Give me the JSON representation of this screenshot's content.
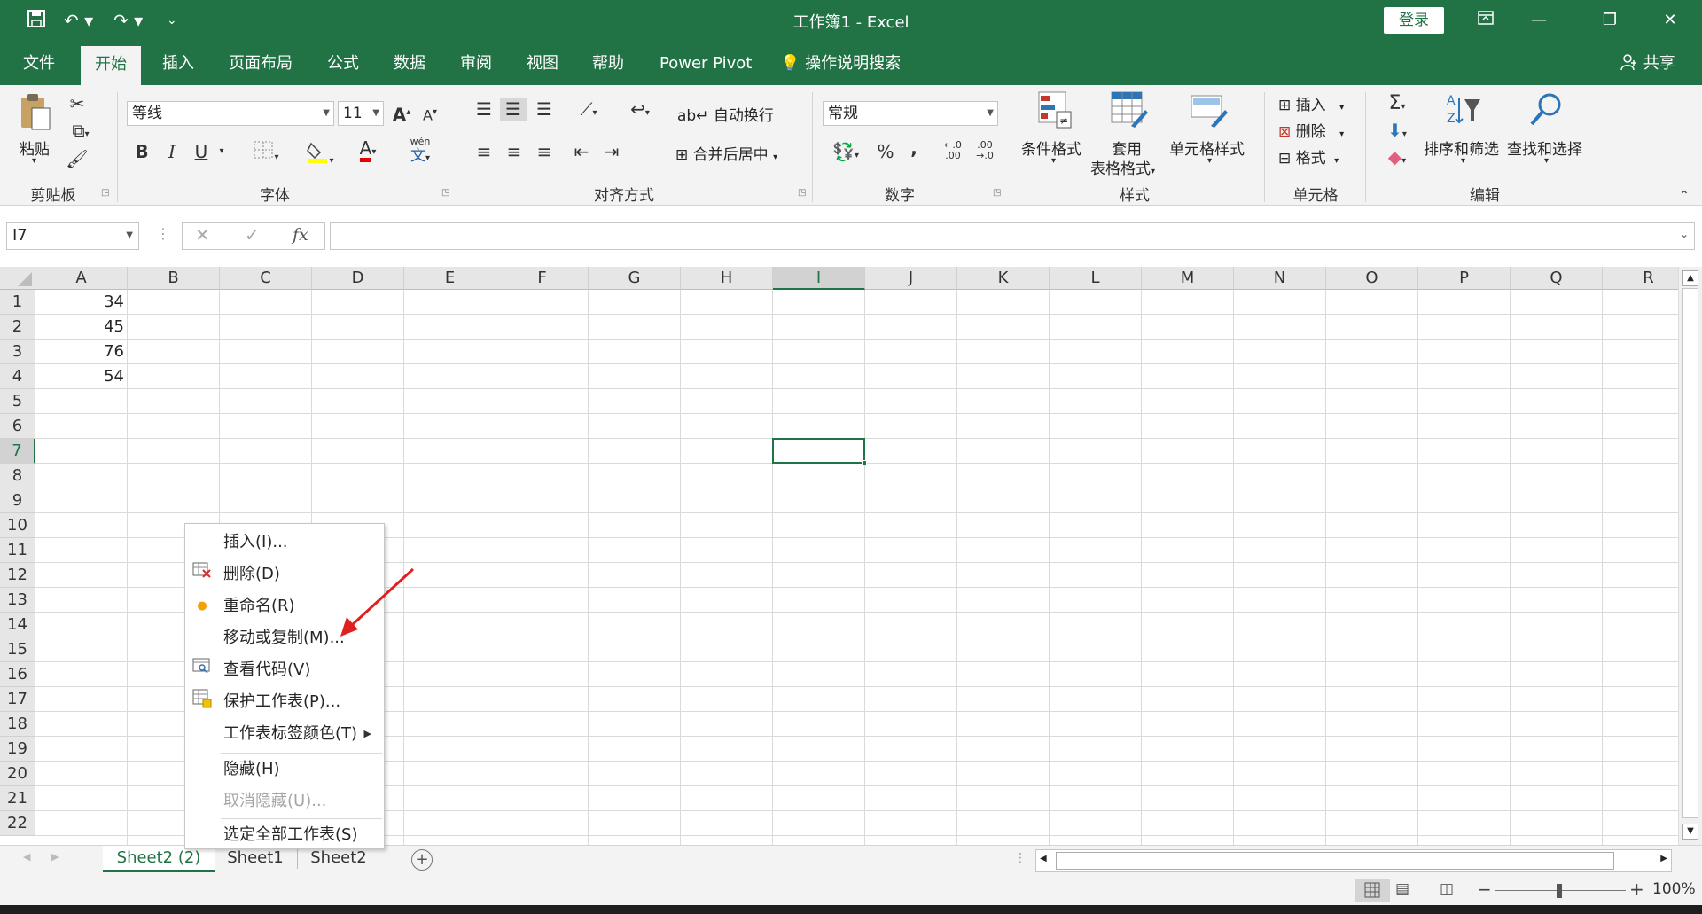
{
  "window": {
    "title": "工作簿1  -  Excel",
    "login_label": "登录",
    "icons": [
      "save-icon",
      "undo-icon",
      "redo-icon",
      "customize-qat-icon",
      "ribbon-display-icon",
      "minimize-icon",
      "restore-icon",
      "close-icon"
    ]
  },
  "tabs": [
    {
      "label": "文件"
    },
    {
      "label": "开始"
    },
    {
      "label": "插入"
    },
    {
      "label": "页面布局"
    },
    {
      "label": "公式"
    },
    {
      "label": "数据"
    },
    {
      "label": "审阅"
    },
    {
      "label": "视图"
    },
    {
      "label": "帮助"
    },
    {
      "label": "Power Pivot"
    }
  ],
  "active_tab": "开始",
  "tell_me_label": "操作说明搜索",
  "share_label": "共享",
  "ribbon": {
    "clipboard": {
      "paste_label": "粘贴",
      "group_label": "剪贴板"
    },
    "font": {
      "font_name": "等线",
      "font_size": "11",
      "group_label": "字体",
      "bold": "B",
      "italic": "I",
      "underline": "U",
      "font_color_glyph": "A",
      "phonetic_top": "wén",
      "phonetic_bottom": "文"
    },
    "alignment": {
      "wrap_label": "自动换行",
      "merge_label": "合并后居中",
      "group_label": "对齐方式"
    },
    "number": {
      "format_value": "常规",
      "percent": "%",
      "comma": ",",
      "inc_decimal": "←.0 .00",
      "dec_decimal": ".00 →.0",
      "group_label": "数字"
    },
    "styles": {
      "conditional_label": "条件格式",
      "table_label_1": "套用",
      "table_label_2": "表格格式",
      "cell_styles_label": "单元格样式",
      "group_label": "样式"
    },
    "cells": {
      "insert_label": "插入",
      "delete_label": "删除",
      "format_label": "格式",
      "group_label": "单元格"
    },
    "editing": {
      "sort_label": "排序和筛选",
      "find_label": "查找和选择",
      "group_label": "编辑",
      "sum_glyph": "Σ"
    }
  },
  "formula_bar": {
    "name_box": "I7",
    "fx_label": "fx",
    "cancel_glyph": "✕",
    "enter_glyph": "✓",
    "value": ""
  },
  "columns": [
    "A",
    "B",
    "C",
    "D",
    "E",
    "F",
    "G",
    "H",
    "I",
    "J",
    "K",
    "L",
    "M",
    "N",
    "O",
    "P",
    "Q",
    "R"
  ],
  "rows": [
    "1",
    "2",
    "3",
    "4",
    "5",
    "6",
    "7",
    "8",
    "9",
    "10",
    "11",
    "12",
    "13",
    "14",
    "15",
    "16",
    "17",
    "18",
    "19",
    "20",
    "21",
    "22"
  ],
  "selected": {
    "column": "I",
    "row": "7"
  },
  "cells": {
    "A1": "34",
    "A2": "45",
    "A3": "76",
    "A4": "54"
  },
  "context_menu": {
    "items": [
      {
        "label": "插入(I)...",
        "icon": "",
        "disabled": false,
        "submenu": false
      },
      {
        "label": "删除(D)",
        "icon": "delete-sheet-icon",
        "disabled": false,
        "submenu": false
      },
      {
        "label": "重命名(R)",
        "icon": "rename-dot-icon",
        "disabled": false,
        "submenu": false
      },
      {
        "label": "移动或复制(M)...",
        "icon": "",
        "disabled": false,
        "submenu": false
      },
      {
        "label": "查看代码(V)",
        "icon": "view-code-icon",
        "disabled": false,
        "submenu": false
      },
      {
        "label": "保护工作表(P)...",
        "icon": "protect-sheet-icon",
        "disabled": false,
        "submenu": false
      },
      {
        "label": "工作表标签颜色(T)",
        "icon": "",
        "disabled": false,
        "submenu": true
      },
      {
        "label": "隐藏(H)",
        "icon": "",
        "disabled": false,
        "submenu": false
      },
      {
        "label": "取消隐藏(U)...",
        "icon": "",
        "disabled": true,
        "submenu": false
      },
      {
        "label": "选定全部工作表(S)",
        "icon": "",
        "disabled": false,
        "submenu": false
      }
    ]
  },
  "sheets": [
    {
      "name": "Sheet2 (2)",
      "active": true
    },
    {
      "name": "Sheet1",
      "active": false
    },
    {
      "name": "Sheet2",
      "active": false
    }
  ],
  "status": {
    "zoom": "100%",
    "minus": "−",
    "plus": "+"
  },
  "colors": {
    "accent": "#217346",
    "arrow": "#e02020"
  }
}
